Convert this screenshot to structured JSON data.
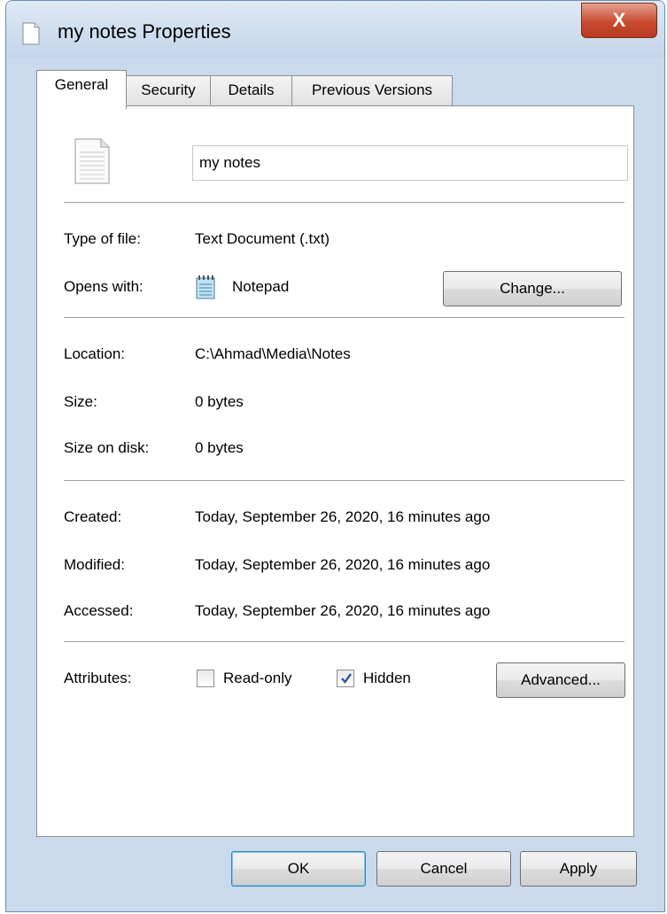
{
  "window": {
    "title": "my notes Properties",
    "close_label": "X"
  },
  "tabs": [
    {
      "label": "General"
    },
    {
      "label": "Security"
    },
    {
      "label": "Details"
    },
    {
      "label": "Previous Versions"
    }
  ],
  "general": {
    "file_name": "my notes",
    "type_of_file": {
      "label": "Type of file:",
      "value": "Text Document (.txt)"
    },
    "opens_with": {
      "label": "Opens with:",
      "value": "Notepad",
      "change_label": "Change..."
    },
    "location": {
      "label": "Location:",
      "value": "C:\\Ahmad\\Media\\Notes"
    },
    "size": {
      "label": "Size:",
      "value": "0 bytes"
    },
    "size_on_disk": {
      "label": "Size on disk:",
      "value": "0 bytes"
    },
    "created": {
      "label": "Created:",
      "value": "Today, September 26, 2020, 16 minutes ago"
    },
    "modified": {
      "label": "Modified:",
      "value": "Today, September 26, 2020, 16 minutes ago"
    },
    "accessed": {
      "label": "Accessed:",
      "value": "Today, September 26, 2020, 16 minutes ago"
    },
    "attributes": {
      "label": "Attributes:",
      "readonly_label": "Read-only",
      "readonly_checked": false,
      "hidden_label": "Hidden",
      "hidden_checked": true,
      "advanced_label": "Advanced..."
    }
  },
  "footer": {
    "ok_label": "OK",
    "cancel_label": "Cancel",
    "apply_label": "Apply"
  },
  "colors": {
    "accent": "#3c7fb1",
    "close": "#c94a2f",
    "frame": "#c9daec"
  }
}
